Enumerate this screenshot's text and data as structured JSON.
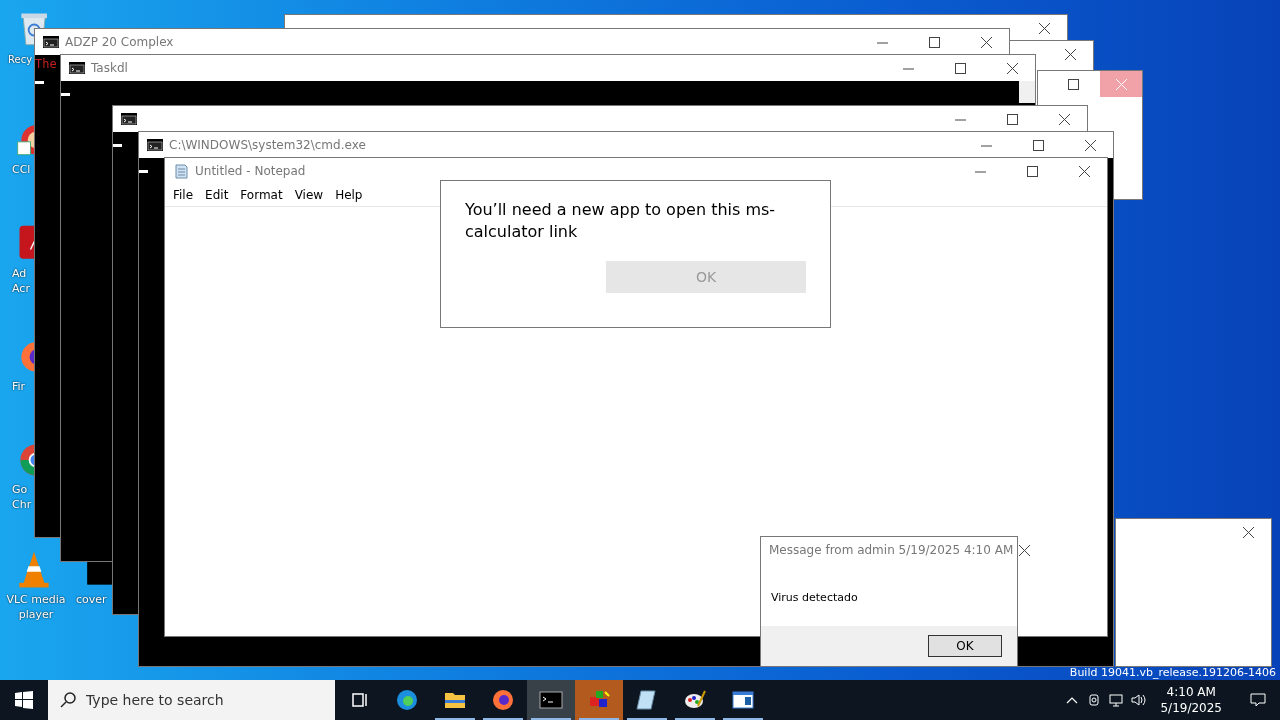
{
  "desktop_icons": [
    {
      "kind": "recycle-bin",
      "lines": [
        "Recy"
      ]
    },
    {
      "kind": "ccleaner",
      "lines": [
        "CCl"
      ]
    },
    {
      "kind": "acrobat",
      "lines": [
        "Ad",
        "Acr"
      ]
    },
    {
      "kind": "firefox",
      "lines": [
        "Fir"
      ]
    },
    {
      "kind": "chrome",
      "lines": [
        "Go",
        "Chr"
      ]
    },
    {
      "kind": "vlc",
      "lines": [
        "VLC media",
        "player"
      ]
    },
    {
      "kind": "file",
      "lines": [
        "cover"
      ]
    }
  ],
  "windows": [
    {
      "kind": "blank"
    },
    {
      "kind": "blank"
    },
    {
      "kind": "blank",
      "close_hover": true
    },
    {
      "kind": "console",
      "title": "ADZP 20 Complex",
      "output": "The"
    },
    {
      "kind": "console",
      "title": "Taskdl"
    },
    {
      "kind": "console"
    },
    {
      "kind": "console",
      "title": "C:\\WINDOWS\\system32\\cmd.exe"
    },
    {
      "kind": "notepad",
      "title": "Untitled - Notepad",
      "menu": [
        "File",
        "Edit",
        "Format",
        "View",
        "Help"
      ]
    },
    {
      "kind": "blank"
    },
    {
      "kind": "dialog",
      "message": "You’ll need a new app to open this ms-calculator link",
      "button": {
        "label": "OK",
        "disabled": true
      }
    },
    {
      "kind": "message",
      "title": "Message from admin 5/19/2025 4:10 AM",
      "message": "Virus detectado",
      "button": {
        "label": "OK",
        "disabled": false
      }
    }
  ],
  "build": "Build 19041.vb_release.191206-1406",
  "taskbar": {
    "search": {
      "placeholder": "Type here to search"
    },
    "apps": [
      {
        "kind": "task-view",
        "running": false,
        "selected": false,
        "flashing": false
      },
      {
        "kind": "edge",
        "running": false,
        "selected": false,
        "flashing": false
      },
      {
        "kind": "folder",
        "running": true,
        "selected": false,
        "flashing": false
      },
      {
        "kind": "firefox",
        "running": true,
        "selected": false,
        "flashing": false
      },
      {
        "kind": "console",
        "running": true,
        "selected": true,
        "flashing": false
      },
      {
        "kind": "cubes",
        "running": true,
        "selected": false,
        "flashing": true
      },
      {
        "kind": "notepad",
        "running": true,
        "selected": false,
        "flashing": false
      },
      {
        "kind": "paint",
        "running": true,
        "selected": false,
        "flashing": false
      },
      {
        "kind": "window",
        "running": true,
        "selected": false,
        "flashing": false
      }
    ],
    "time": "4:10 AM",
    "date": "5/19/2025"
  }
}
